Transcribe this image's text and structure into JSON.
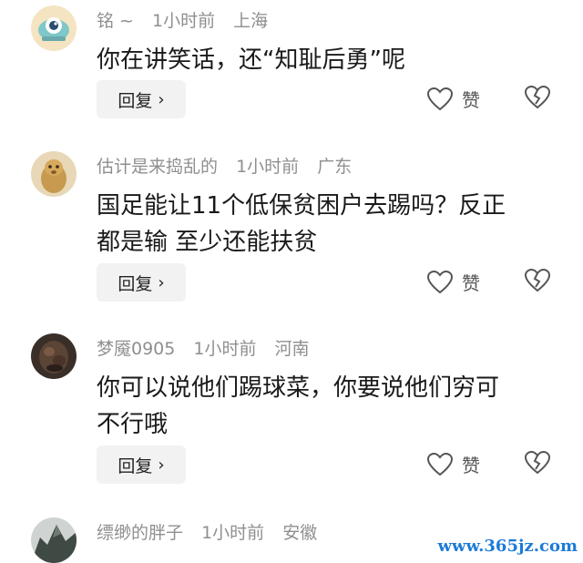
{
  "comments": [
    {
      "username": "铭 ~",
      "time": "1小时前",
      "location": "上海",
      "text": "你在讲笑话，还“知耻后勇”呢",
      "reply_label": "回复",
      "like_label": "赞"
    },
    {
      "username": "估计是来捣乱的",
      "time": "1小时前",
      "location": "广东",
      "text": "国足能让11个低保贫困户去踢吗？反正\n都是输 至少还能扶贫",
      "reply_label": "回复",
      "like_label": "赞"
    },
    {
      "username": "梦魇0905",
      "time": "1小时前",
      "location": "河南",
      "text": "你可以说他们踢球菜，你要说他们穷可\n不行哦",
      "reply_label": "回复",
      "like_label": "赞"
    },
    {
      "username": "缥缈的胖子",
      "time": "1小时前",
      "location": "安徽",
      "text": "",
      "reply_label": "",
      "like_label": ""
    }
  ],
  "watermark": "www.365jz.com"
}
